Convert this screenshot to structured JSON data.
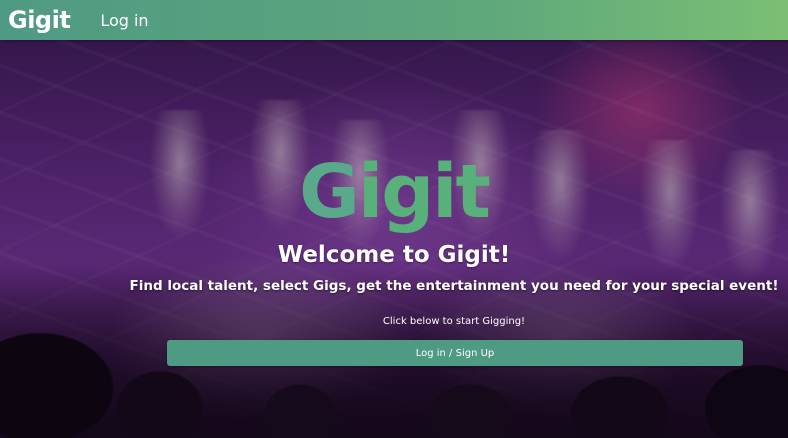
{
  "navbar": {
    "brand": "Gigit",
    "login_link": "Log in"
  },
  "hero": {
    "logo_first_letter": "G",
    "logo_rest": "igit",
    "welcome": "Welcome to Gigit!",
    "tagline": "Find local talent, select Gigs, get the entertainment you need for your special event!",
    "cta_hint": "Click below to start Gigging!",
    "cta_button": "Log in / Sign Up"
  },
  "colors": {
    "navbar_start": "#4f9a83",
    "navbar_end": "#7bbf74",
    "button": "#4f9a83",
    "logo_green": "#58b07a"
  }
}
